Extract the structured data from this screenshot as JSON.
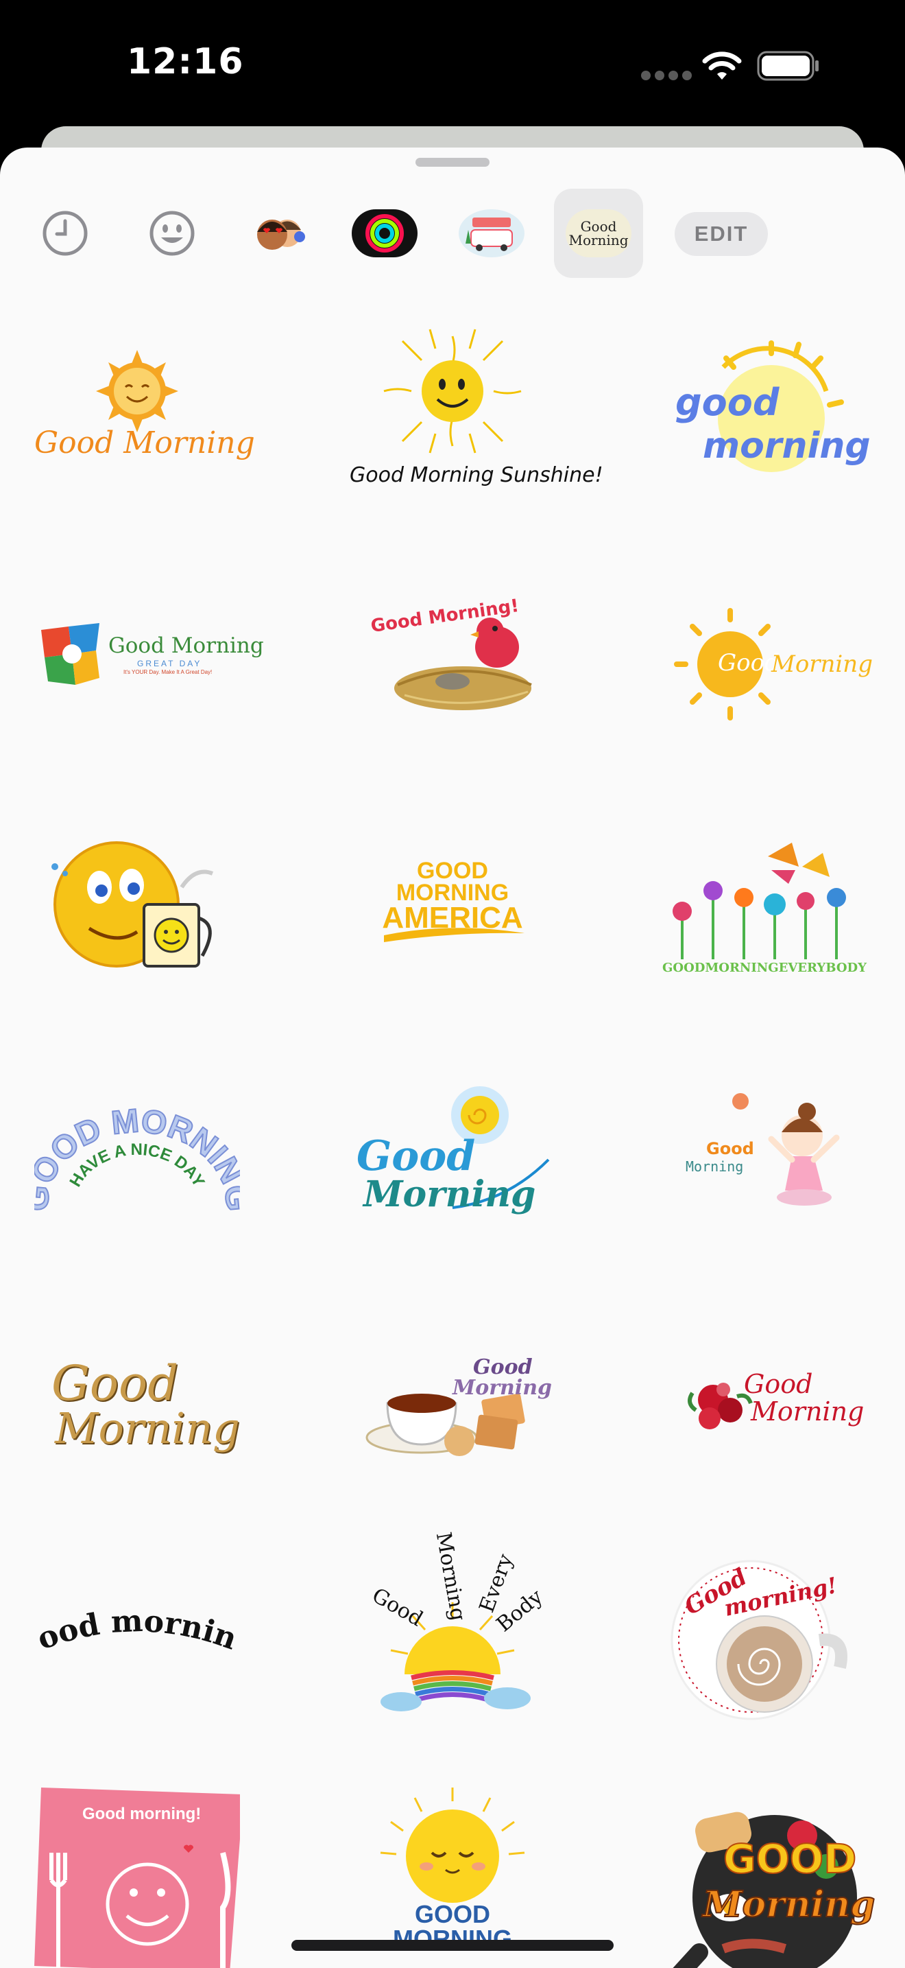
{
  "status_bar": {
    "time": "12:16",
    "icons": [
      "cellular-dots-icon",
      "wifi-icon",
      "battery-icon"
    ]
  },
  "toolbar": {
    "items": [
      {
        "name": "recents-clock-icon"
      },
      {
        "name": "emoji-smiley-icon"
      },
      {
        "name": "memoji-pack"
      },
      {
        "name": "activity-rings-pack"
      },
      {
        "name": "travel-stickers-pack"
      },
      {
        "name": "good-morning-pack",
        "line1": "Good",
        "line2": "Morning",
        "selected": true
      }
    ],
    "edit_label": "EDIT"
  },
  "stickers": [
    {
      "name": "sticker-good-morning-sun-orange",
      "text": "Good Morning"
    },
    {
      "name": "sticker-good-morning-sunshine",
      "text": "Good Morning Sunshine!"
    },
    {
      "name": "sticker-good-morning-blue-sun",
      "line1": "good",
      "line2": "morning"
    },
    {
      "name": "sticker-good-morning-great-day",
      "text": "Good Morning",
      "sub": "GREAT DAY",
      "small": "It's YOUR Day. Make It A Great Day!"
    },
    {
      "name": "sticker-good-morning-bird-nest",
      "text": "Good Morning!"
    },
    {
      "name": "sticker-good-morning-yellow-sun",
      "line1": "Good",
      "line2": "Morning"
    },
    {
      "name": "sticker-smiley-coffee-mug"
    },
    {
      "name": "sticker-good-morning-america",
      "line1": "GOOD",
      "line2": "MORNING",
      "line3": "AMERICA"
    },
    {
      "name": "sticker-good-morning-everybody-flowers",
      "text": "GOODMORNINGEVERYBODY"
    },
    {
      "name": "sticker-good-morning-nice-day",
      "line1": "GOOD MORNING",
      "line2": "HAVE A NICE DAY"
    },
    {
      "name": "sticker-good-morning-blue-script",
      "line1": "Good",
      "line2": "Morning"
    },
    {
      "name": "sticker-good-morning-girl",
      "line1": "Good",
      "line2": "Morning"
    },
    {
      "name": "sticker-good-morning-gold-script",
      "line1": "Good",
      "line2": "Morning"
    },
    {
      "name": "sticker-good-morning-tea-biscuits",
      "line1": "Good",
      "line2": "Morning"
    },
    {
      "name": "sticker-good-morning-roses",
      "line1": "Good",
      "line2": "Morning"
    },
    {
      "name": "sticker-good-morning-black-arc",
      "text": "good morning"
    },
    {
      "name": "sticker-good-morning-every-body-rainbow",
      "w1": "Good",
      "w2": "Morning",
      "w3": "Every",
      "w4": "Body"
    },
    {
      "name": "sticker-good-morning-coffee-cup",
      "line1": "Good",
      "line2": "morning!"
    },
    {
      "name": "sticker-good-morning-plate",
      "text": "Good morning!"
    },
    {
      "name": "sticker-good-morning-sleepy-sun",
      "line1": "GOOD",
      "line2": "MORNING"
    },
    {
      "name": "sticker-good-morning-breakfast-pan",
      "line1": "GOOD",
      "line2": "Morning"
    }
  ]
}
